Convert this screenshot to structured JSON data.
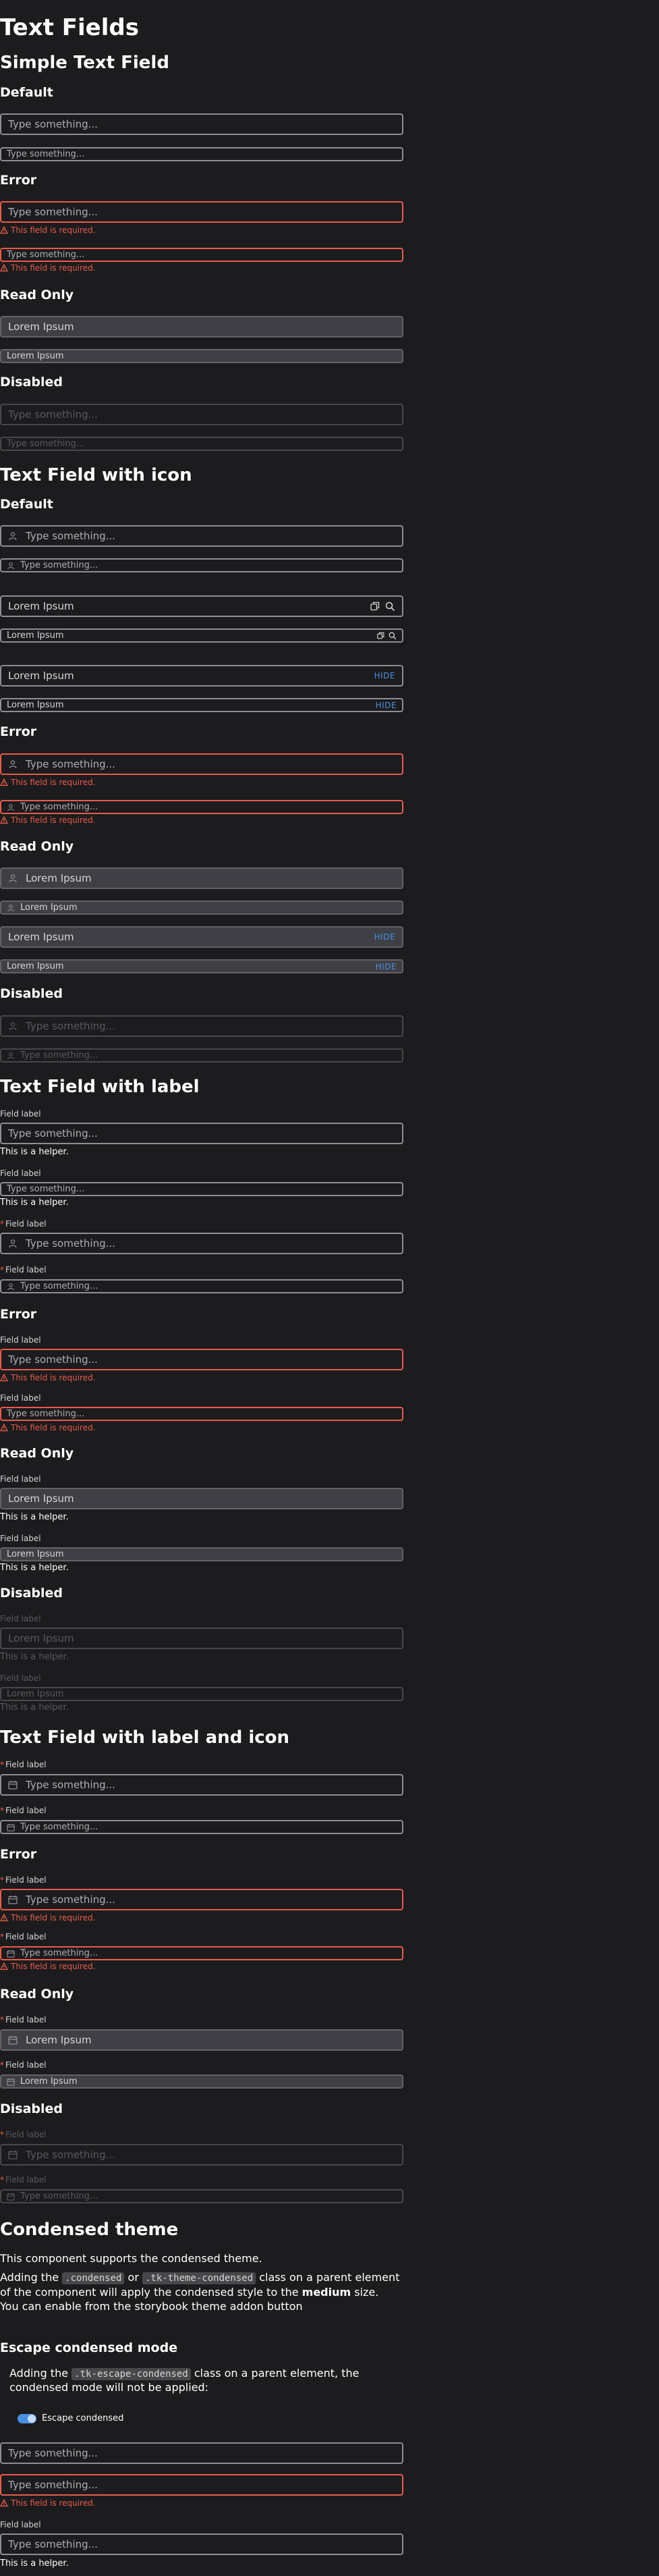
{
  "page": {
    "title": "Text Fields",
    "placeholder": "Type something...",
    "filled_value": "Lorem Ipsum",
    "error_message": "This field is required.",
    "field_label": "Field label",
    "helper": "This is a helper.",
    "required_mark": "*",
    "hide_label": "HIDE"
  },
  "sections": {
    "simple": "Simple Text Field",
    "with_icon": "Text Field with icon",
    "with_label": "Text Field with label",
    "with_label_icon": "Text Field with label and icon",
    "condensed": "Condensed theme",
    "escape": "Escape condensed mode"
  },
  "states": {
    "default": "Default",
    "error": "Error",
    "read_only": "Read Only",
    "disabled": "Disabled"
  },
  "condensed": {
    "p1": "This component supports the condensed theme.",
    "p2_a": "Adding the ",
    "code1": ".condensed",
    "p2_b": " or ",
    "code2": ".tk-theme-condensed",
    "p2_c": " class on a parent element",
    "p3_a": "of the component will apply the condensed style to the ",
    "p3_bold": "medium",
    "p3_b": " size.",
    "p4": "You can enable from the storybook theme addon button"
  },
  "escape": {
    "p1_a": "Adding the ",
    "code": ".tk-escape-condensed",
    "p1_b": " class on a parent element, the",
    "p2": "condensed mode will not be applied:",
    "toggle_label": "Escape condensed"
  },
  "colors": {
    "background": "#1c1c1e",
    "border": "#8e8e93",
    "error": "#e85b4a",
    "read_only_bg": "#3f3f45",
    "accent": "#4a90e2"
  },
  "icons": [
    "user-icon",
    "copy-icon",
    "search-icon",
    "calendar-icon",
    "alert-icon"
  ]
}
